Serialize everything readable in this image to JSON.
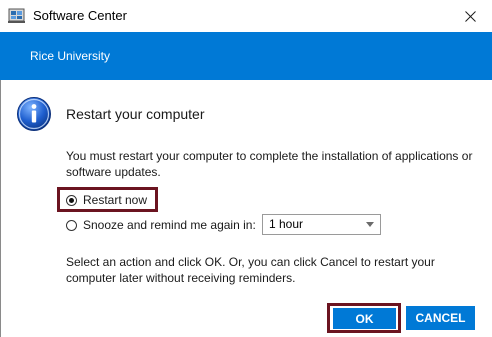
{
  "window": {
    "title": "Software Center",
    "close_glyph": "✕",
    "app_icon": "software-center-icon"
  },
  "banner": {
    "org_name": "Rice University",
    "color": "#0079d6"
  },
  "dialog": {
    "icon": "info-icon",
    "heading": "Restart your computer",
    "message": "You must restart your computer to complete the installation of applications or software updates.",
    "options": {
      "restart_now": {
        "label": "Restart now",
        "selected": true
      },
      "snooze": {
        "label": "Snooze and remind me again in:",
        "selected": false
      }
    },
    "snooze_select": {
      "value": "1 hour"
    },
    "footnote": "Select an action and click OK.  Or, you can click Cancel to restart your computer later without receiving reminders."
  },
  "buttons": {
    "ok": "OK",
    "cancel": "CANCEL"
  },
  "colors": {
    "accent": "#0079d6",
    "highlight_border": "#6b1420"
  }
}
